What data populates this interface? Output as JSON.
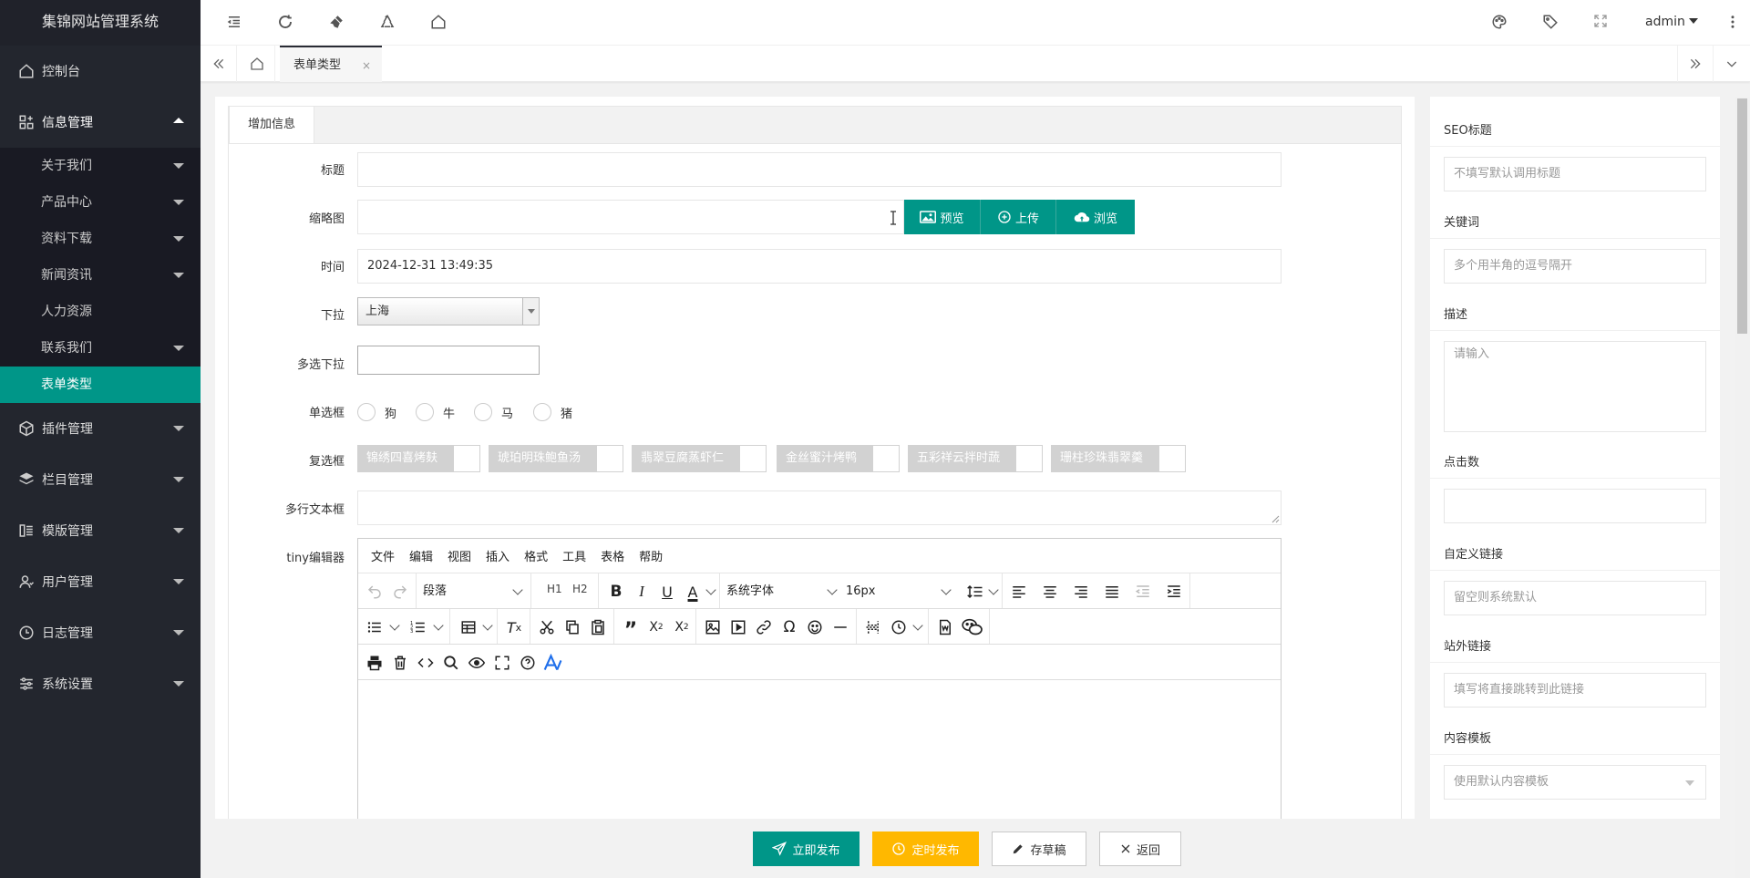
{
  "app": {
    "title": "集锦网站管理系统",
    "user": "admin"
  },
  "sidebar": {
    "items": [
      {
        "label": "控制台",
        "icon": "home-icon"
      },
      {
        "label": "信息管理",
        "icon": "info-manage-icon",
        "sub": [
          {
            "label": "关于我们"
          },
          {
            "label": "产品中心"
          },
          {
            "label": "资料下载"
          },
          {
            "label": "新闻资讯"
          },
          {
            "label": "人力资源"
          },
          {
            "label": "联系我们"
          },
          {
            "label": "表单类型"
          }
        ]
      },
      {
        "label": "插件管理",
        "icon": "plugin-icon"
      },
      {
        "label": "栏目管理",
        "icon": "layers-icon"
      },
      {
        "label": "模版管理",
        "icon": "template-icon"
      },
      {
        "label": "用户管理",
        "icon": "user-icon"
      },
      {
        "label": "日志管理",
        "icon": "clock-icon"
      },
      {
        "label": "系统设置",
        "icon": "sliders-icon"
      }
    ]
  },
  "tabs": {
    "current": "表单类型",
    "close": "×"
  },
  "form": {
    "tab": "增加信息",
    "title_label": "标题",
    "thumb_label": "缩略图",
    "preview_btn": "预览",
    "upload_btn": "上传",
    "browse_btn": "浏览",
    "time_label": "时间",
    "time_value": "2024-12-31 13:49:35",
    "dropdown_label": "下拉",
    "dropdown_value": "上海",
    "multiselect_label": "多选下拉",
    "radio_label": "单选框",
    "radios": [
      "狗",
      "牛",
      "马",
      "猪"
    ],
    "checkbox_label": "复选框",
    "checkboxes": [
      "锦绣四喜烤麸",
      "琥珀明珠鲍鱼汤",
      "翡翠豆腐蒸虾仁",
      "金丝蜜汁烤鸭",
      "五彩祥云拌时蔬",
      "珊柱珍珠翡翠羹"
    ],
    "textarea_label": "多行文本框",
    "editor_label": "tiny编辑器"
  },
  "editor": {
    "menus": [
      "文件",
      "编辑",
      "视图",
      "插入",
      "格式",
      "工具",
      "表格",
      "帮助"
    ],
    "block": "段落",
    "h1": "H1",
    "h2": "H2",
    "font": "系统字体",
    "size": "16px"
  },
  "seo": {
    "seo_title_label": "SEO标题",
    "seo_title_placeholder": "不填写默认调用标题",
    "keywords_label": "关键词",
    "keywords_placeholder": "多个用半角的逗号隔开",
    "desc_label": "描述",
    "desc_placeholder": "请输入",
    "clicks_label": "点击数",
    "custom_link_label": "自定义链接",
    "custom_link_placeholder": "留空则系统默认",
    "ext_link_label": "站外链接",
    "ext_link_placeholder": "填写将直接跳转到此链接",
    "tpl_label": "内容模板",
    "tpl_value": "使用默认内容模板"
  },
  "actions": {
    "publish": "立即发布",
    "schedule": "定时发布",
    "draft": "存草稿",
    "back": "返回"
  },
  "colors": {
    "accent": "#009688",
    "warn": "#ffb800",
    "sidebar": "#23262e"
  }
}
